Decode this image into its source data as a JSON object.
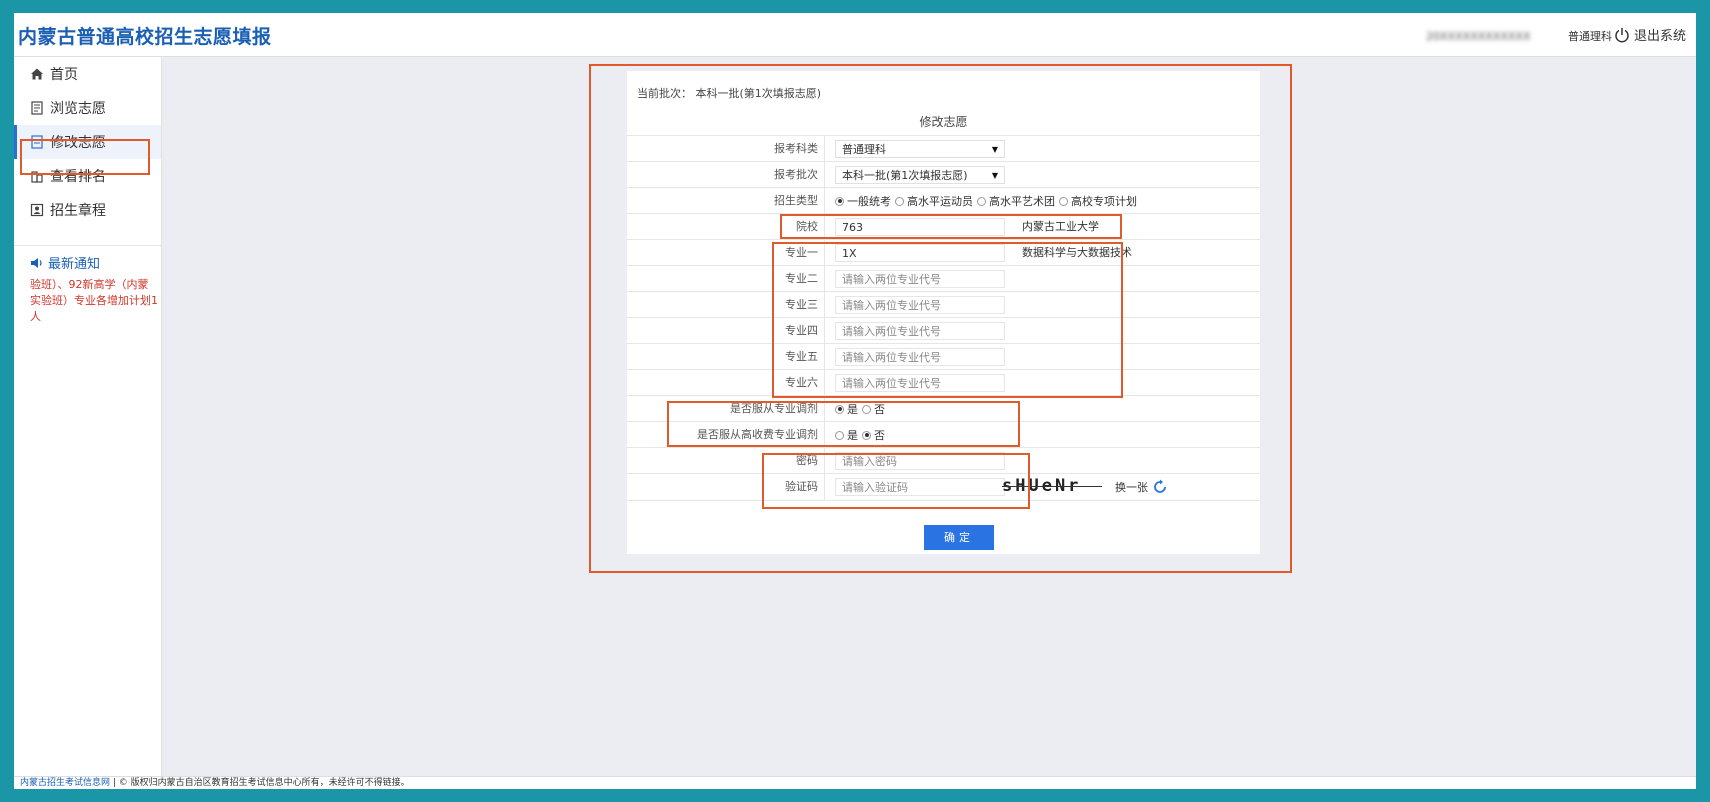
{
  "header": {
    "title": "内蒙古普通高校招生志愿填报",
    "user_id": "20XXXXXXXXXXXX",
    "user_subject": "普通理科",
    "logout_label": "退出系统"
  },
  "sidebar": {
    "items": [
      {
        "label": "首页",
        "icon": "home-icon"
      },
      {
        "label": "浏览志愿",
        "icon": "document-icon"
      },
      {
        "label": "修改志愿",
        "icon": "edit-icon"
      },
      {
        "label": "查看排名",
        "icon": "building-icon"
      },
      {
        "label": "招生章程",
        "icon": "profile-icon"
      }
    ],
    "notice_title": "最新通知",
    "notice_text": "验班）、92新高学（内蒙实验班）专业各增加计划1人"
  },
  "form": {
    "batch_label": "当前批次：",
    "batch_value": "本科一批(第1次填报志愿)",
    "title": "修改志愿",
    "subject_label": "报考科类",
    "subject_value": "普通理科",
    "batch_select_label": "报考批次",
    "batch_select_value": "本科一批(第1次填报志愿)",
    "type_label": "招生类型",
    "type_options": [
      "一般统考",
      "高水平运动员",
      "高水平艺术团",
      "高校专项计划"
    ],
    "school_label": "院校",
    "school_code": "763",
    "school_name": "内蒙古工业大学",
    "majors": [
      {
        "label": "专业一",
        "value": "1X",
        "name": "数据科学与大数据技术"
      },
      {
        "label": "专业二",
        "value": "",
        "name": ""
      },
      {
        "label": "专业三",
        "value": "",
        "name": ""
      },
      {
        "label": "专业四",
        "value": "",
        "name": ""
      },
      {
        "label": "专业五",
        "value": "",
        "name": ""
      },
      {
        "label": "专业六",
        "value": "",
        "name": ""
      }
    ],
    "major_placeholder": "请输入两位专业代号",
    "obey_major_label": "是否服从专业调剂",
    "obey_fee_label": "是否服从高收费专业调剂",
    "yes_label": "是",
    "no_label": "否",
    "password_label": "密码",
    "password_placeholder": "请输入密码",
    "captcha_label": "验证码",
    "captcha_placeholder": "请输入验证码",
    "captcha_text": "sHUeNr",
    "refresh_label": "换一张",
    "submit_label": "确定"
  },
  "footer": {
    "org": "内蒙古招生考试信息网",
    "copyright": "| © 版权归内蒙古自治区教育招生考试信息中心所有，未经许可不得链接。"
  },
  "colors": {
    "brand": "#1a5fb4",
    "highlight": "#e05a2b",
    "button": "#2a73e3",
    "frame": "#1a96a6"
  }
}
